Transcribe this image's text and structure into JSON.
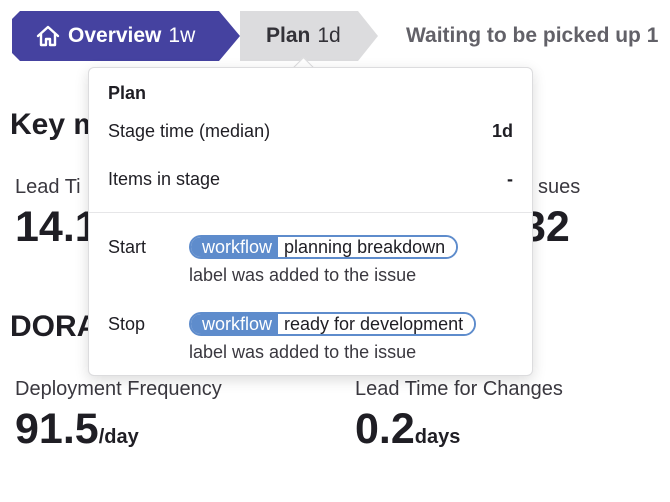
{
  "stages": {
    "overview": {
      "name": "Overview",
      "duration": "1w",
      "icon": "home-icon",
      "color": "#4542a0"
    },
    "plan": {
      "name": "Plan",
      "duration": "1d"
    },
    "waiting": {
      "name": "Waiting to be picked up 1"
    }
  },
  "key_metrics": {
    "title": "Key m",
    "lead_time": {
      "label": "Lead Ti",
      "value": "14.1"
    },
    "issues": {
      "label": "sues",
      "value": "32"
    }
  },
  "dora": {
    "title": "DORA",
    "deployment_frequency": {
      "label": "Deployment Frequency",
      "value": "91.5",
      "unit": "/day"
    },
    "lead_time_changes": {
      "label": "Lead Time for Changes",
      "value": "0.2",
      "unit": "days"
    }
  },
  "popover": {
    "title": "Plan",
    "stage_time_label": "Stage time (median)",
    "stage_time_value": "1d",
    "items_label": "Items in stage",
    "items_value": "-",
    "start": {
      "label": "Start",
      "scope_key": "workflow",
      "scope_value": "planning breakdown",
      "description": "label was added to the issue"
    },
    "stop": {
      "label": "Stop",
      "scope_key": "workflow",
      "scope_value": "ready for development",
      "description": "label was added to the issue"
    },
    "label_color": "#5e8ccc"
  }
}
